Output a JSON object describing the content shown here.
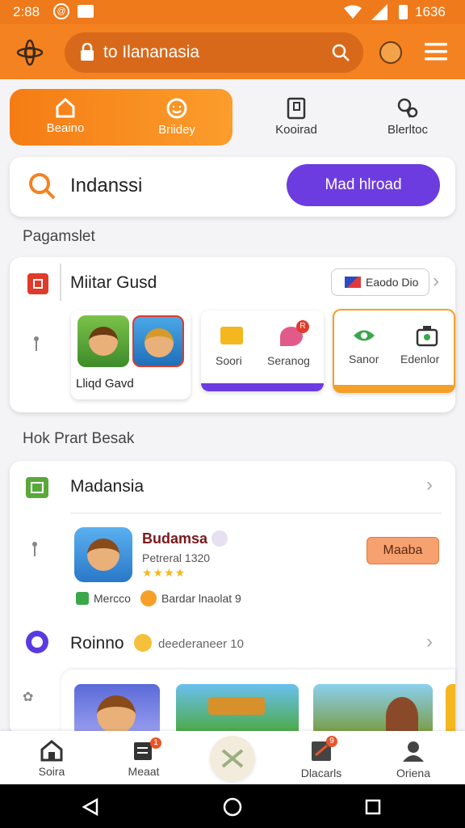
{
  "status_bar": {
    "time": "2:88",
    "battery": "1636"
  },
  "search": {
    "text": "to Ilananasia"
  },
  "quick_tabs": [
    {
      "label": "Beaino"
    },
    {
      "label": "Briidey"
    },
    {
      "label": "Kooirad"
    },
    {
      "label": "Blerltoc"
    }
  ],
  "promo": {
    "title": "Indanssi",
    "button": "Mad hlroad"
  },
  "section1": {
    "title": "Pagamslet"
  },
  "card1": {
    "title": "Miitar Gusd",
    "badge": "Eaodo Dio",
    "game_label": "Lliqd Gavd",
    "items": [
      {
        "label": "Soori"
      },
      {
        "label": "Seranog"
      },
      {
        "label": "Sanor"
      },
      {
        "label": "Edenlor"
      }
    ],
    "notif": "R"
  },
  "section2": {
    "title": "Hok Prart Besak"
  },
  "card2": {
    "title": "Madansia",
    "game_name": "Budamsa",
    "game_sub": "Petreral 1320",
    "action": "Maaba",
    "tag1": "Mercco",
    "tag2": "Bardar lnaolat 9",
    "row_title": "Roinno",
    "row_sub": "deederaneer 10"
  },
  "bottom_nav": [
    {
      "label": "Soira"
    },
    {
      "label": "Meaat",
      "badge": "1"
    },
    {
      "label": ""
    },
    {
      "label": "Dlacarls",
      "badge": "9"
    },
    {
      "label": "Oriena"
    }
  ],
  "colors": {
    "orange": "#f58220",
    "purple": "#6c3ce0",
    "status": "#ef7a1c"
  }
}
